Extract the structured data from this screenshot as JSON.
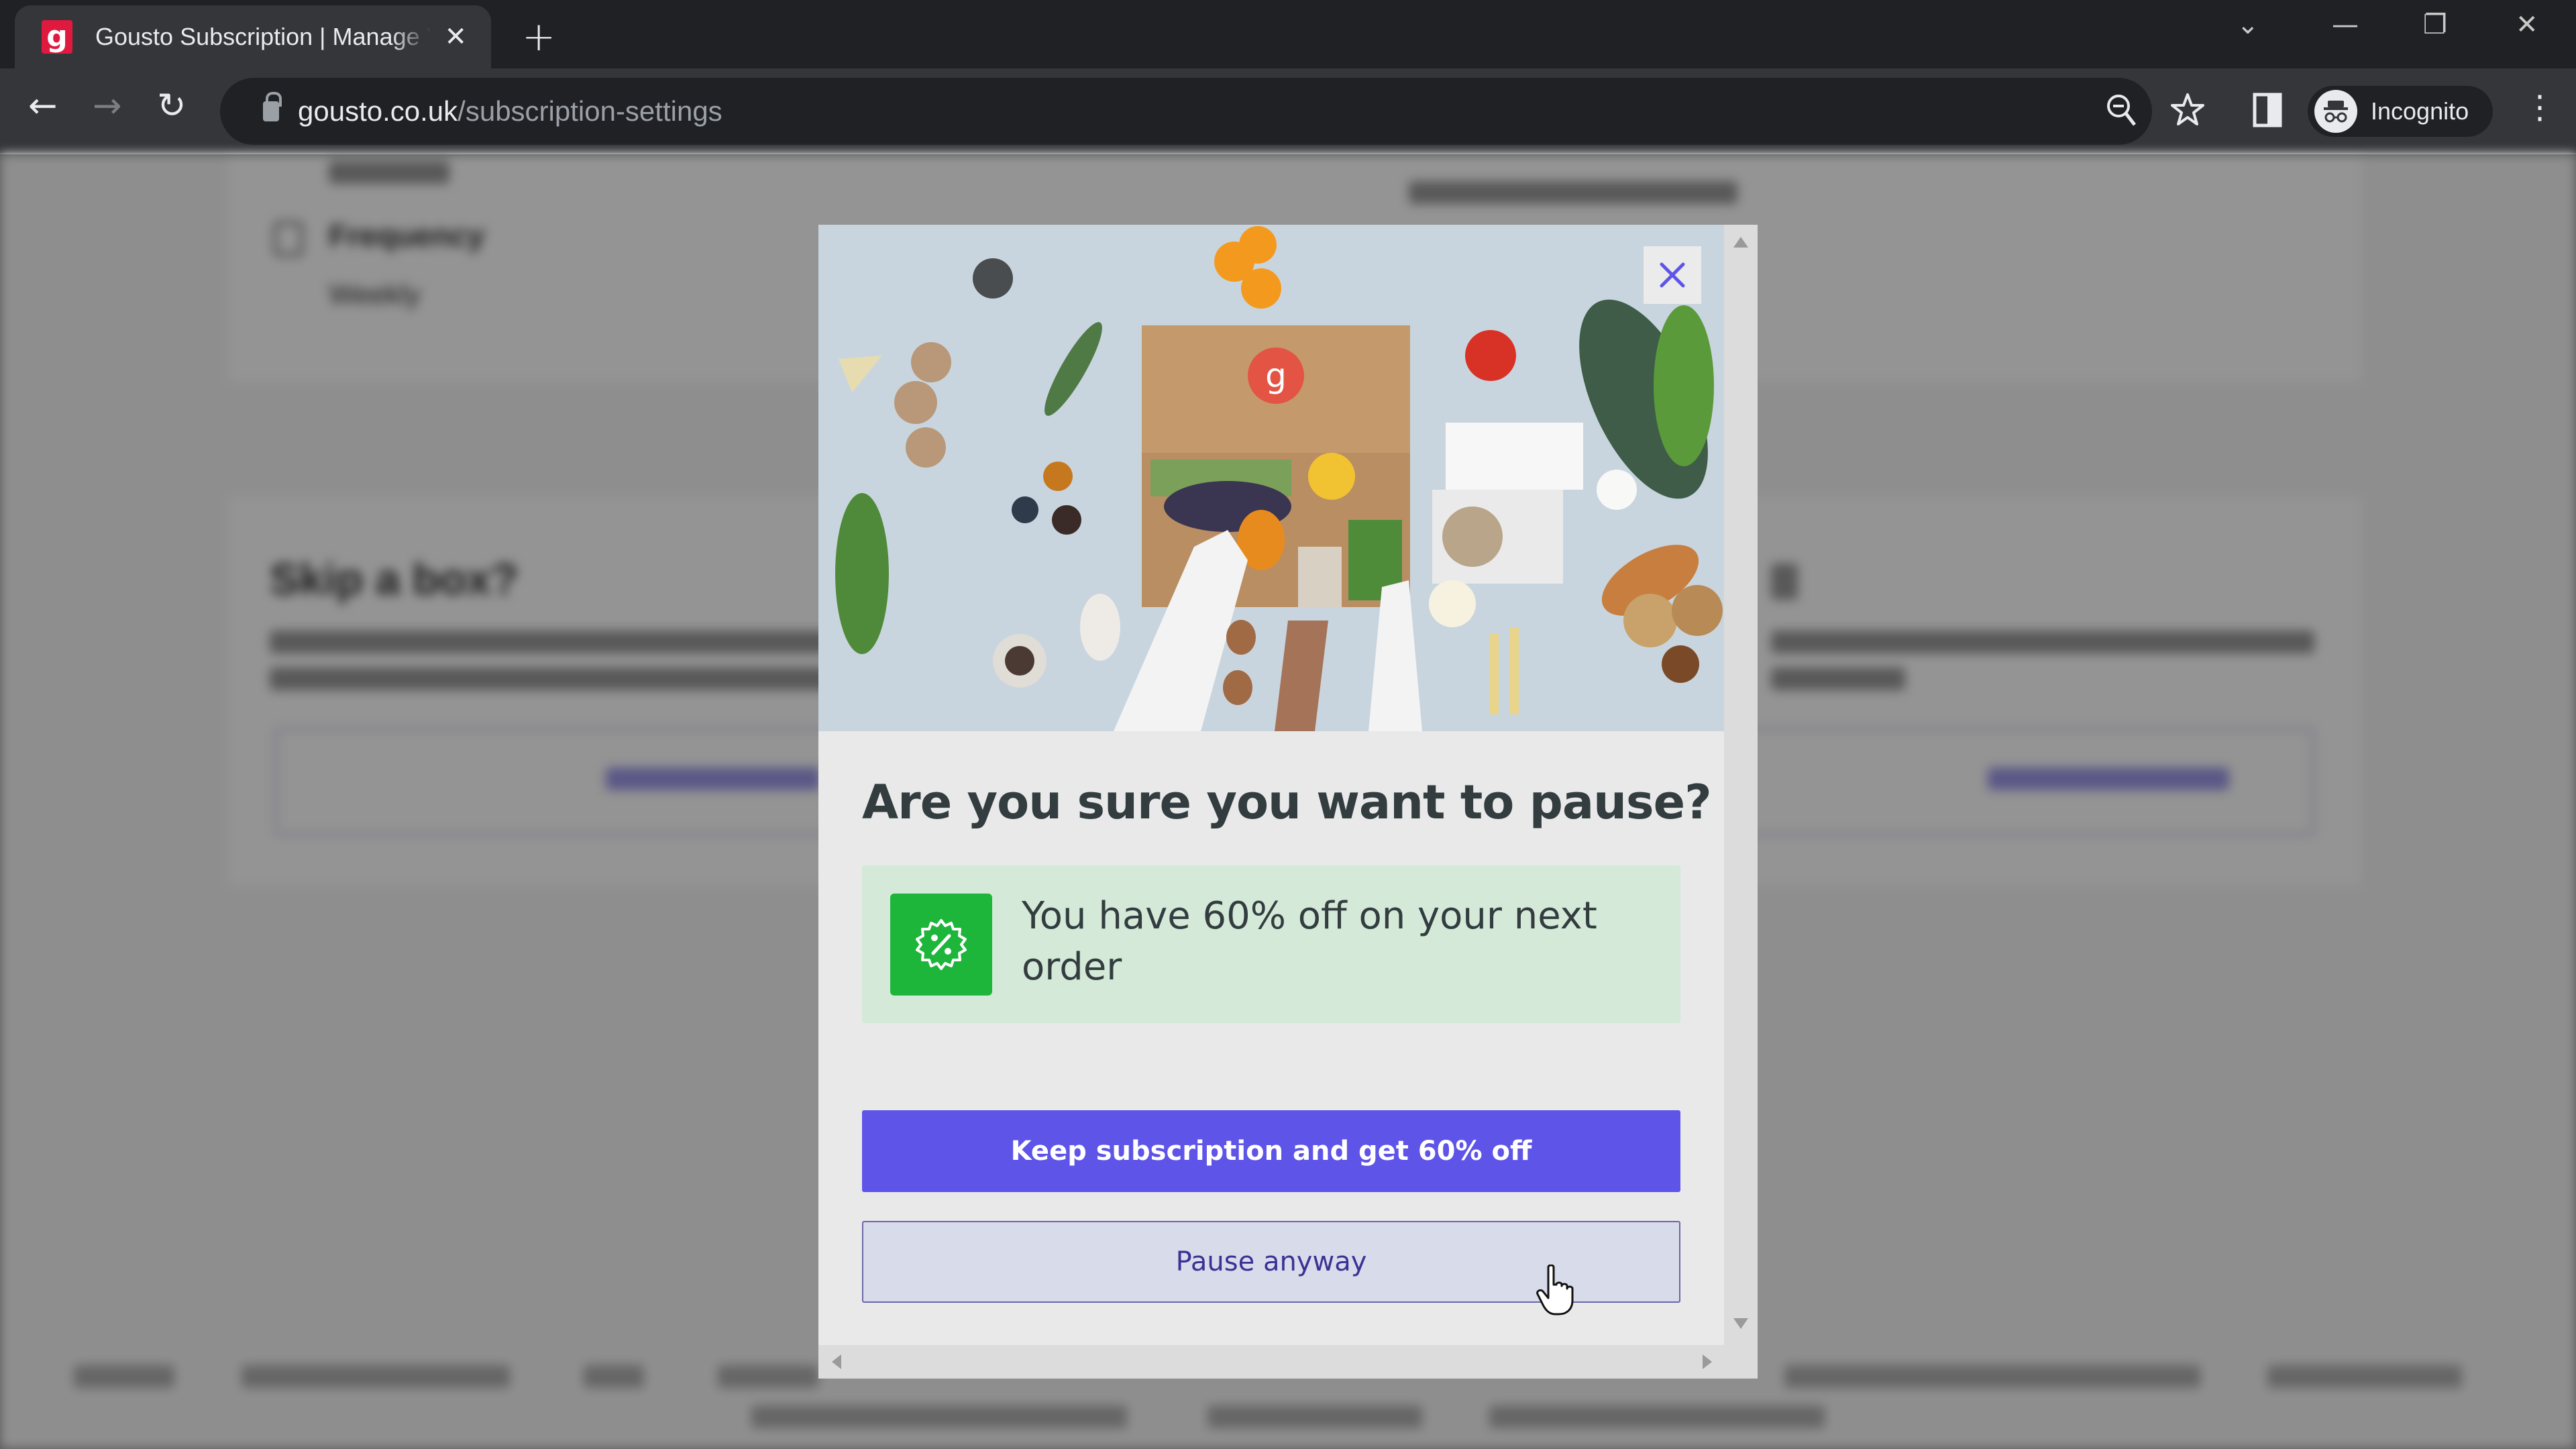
{
  "browser": {
    "tab": {
      "favicon_glyph": "g",
      "title": "Gousto Subscription | Manage Your Subscription",
      "close_glyph": "✕"
    },
    "new_tab_glyph": "+",
    "window_controls": {
      "tab_search": "⌄",
      "minimize": "—",
      "restore": "❐",
      "close": "✕"
    },
    "nav": {
      "back": "←",
      "forward": "→",
      "reload": "↻"
    },
    "address": {
      "host": "gousto.co.uk",
      "path": "/subscription-settings"
    },
    "toolbar_icons": {
      "zoom": "zoom-out-icon",
      "bookmark": "star-icon",
      "side_panel": "side-panel-icon"
    },
    "profile": {
      "label": "Incognito"
    },
    "menu_glyph": "⋮"
  },
  "background_page": {
    "frequency_label": "Frequency",
    "frequency_value": "Weekly",
    "skip_heading": "Skip a box?"
  },
  "modal": {
    "close_label": "Close",
    "title": "Are you sure you want to pause?",
    "offer": {
      "icon": "discount-badge-icon",
      "text": "You have 60% off on your next order"
    },
    "primary_button": "Keep subscription and get 60% off",
    "secondary_button": "Pause anyway"
  },
  "colors": {
    "brand_red": "#e0193f",
    "primary_button": "#5e54e8",
    "secondary_button_bg": "#d8dbe9",
    "secondary_button_text": "#3c3296",
    "offer_bg": "#d4e9d7",
    "offer_icon_bg": "#1db53a",
    "close_icon": "#5e54e8",
    "heading_text": "#333d40"
  }
}
